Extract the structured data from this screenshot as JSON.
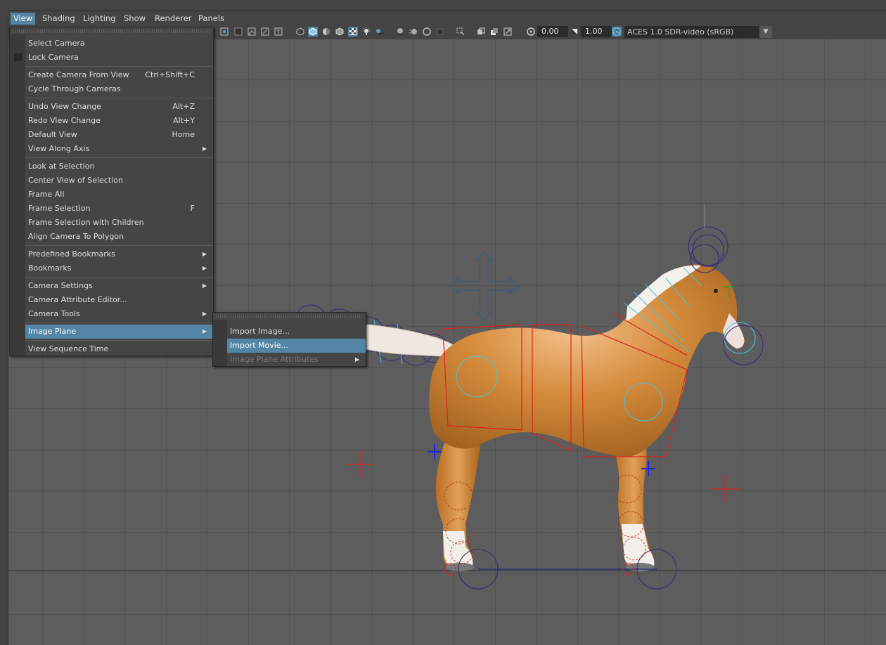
{
  "menubar": {
    "items": [
      "View",
      "Shading",
      "Lighting",
      "Show",
      "Renderer",
      "Panels"
    ],
    "active": "View"
  },
  "toolbar": {
    "exposure_value": "0.00",
    "gamma_value": "1.00",
    "color_management": "ACES 1.0 SDR-video (sRGB)"
  },
  "view_menu": {
    "items": [
      {
        "label": "Select Camera"
      },
      {
        "label": "Lock Camera"
      },
      {
        "label": "Create Camera From View",
        "shortcut": "Ctrl+Shift+C"
      },
      {
        "label": "Cycle Through Cameras"
      },
      {
        "label": "Undo View Change",
        "shortcut": "Alt+Z"
      },
      {
        "label": "Redo View Change",
        "shortcut": "Alt+Y"
      },
      {
        "label": "Default View",
        "shortcut": "Home"
      },
      {
        "label": "View Along Axis"
      },
      {
        "label": "Look at Selection"
      },
      {
        "label": "Center View of Selection"
      },
      {
        "label": "Frame All"
      },
      {
        "label": "Frame Selection",
        "shortcut": "F"
      },
      {
        "label": "Frame Selection with Children"
      },
      {
        "label": "Align Camera To Polygon"
      },
      {
        "label": "Predefined Bookmarks"
      },
      {
        "label": "Bookmarks"
      },
      {
        "label": "Camera Settings"
      },
      {
        "label": "Camera Attribute Editor..."
      },
      {
        "label": "Camera Tools"
      },
      {
        "label": "Image Plane"
      },
      {
        "label": "View Sequence Time"
      }
    ]
  },
  "image_plane_submenu": {
    "items": [
      {
        "label": "Import Image..."
      },
      {
        "label": "Import Movie..."
      },
      {
        "label": "Image Plane Attributes"
      }
    ]
  },
  "colors": {
    "highlight": "#5285a6",
    "viewport_bg": "#5d5d5d",
    "grid_line": "#4a4a4a",
    "horse_body": "#d48a3a",
    "rig_red": "#e02020",
    "rig_cyan": "#40c8e0",
    "rig_purple": "#3a2a7a"
  }
}
